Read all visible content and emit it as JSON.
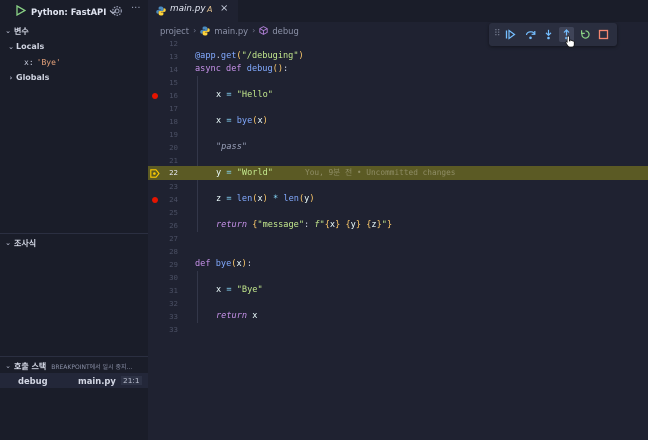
{
  "sidebar": {
    "config_label": "Python: FastAPI",
    "sections": {
      "variables": "변수",
      "locals": "Locals",
      "globals": "Globals",
      "watch": "조사식",
      "call_stack": "호출 스택",
      "call_stack_status": "BREAKPOINT에서 일시 중지..."
    },
    "locals": [
      {
        "name": "x",
        "sep": ":",
        "value": "'Bye'"
      }
    ],
    "call_stack_frame": {
      "function": "debug",
      "file": "main.py",
      "position": "21:1"
    }
  },
  "editor": {
    "tab": {
      "filename": "main.py",
      "modifier": "A",
      "close": "×"
    },
    "breadcrumb": {
      "folder": "project",
      "file": "main.py",
      "symbol": "debug"
    },
    "current_line_blame": "You, 9분 전 • Uncommitted changes",
    "debug_toolbar": [
      "continue",
      "step-over",
      "step-into",
      "step-out",
      "restart",
      "stop"
    ],
    "line_numbers": [
      "12",
      "13",
      "14",
      "15",
      "16",
      "17",
      "18",
      "19",
      "20",
      "21",
      "22",
      "23",
      "24",
      "25",
      "26",
      "27",
      "28",
      "29",
      "30",
      "31",
      "32",
      "33"
    ]
  },
  "colors": {
    "background": "#1f2231",
    "sidebar": "#1a1d29",
    "current_line": "#5b5a24",
    "breakpoint": "#e51400",
    "keyword": "#c792ea",
    "string": "#c3e88d",
    "function": "#82aaff"
  }
}
